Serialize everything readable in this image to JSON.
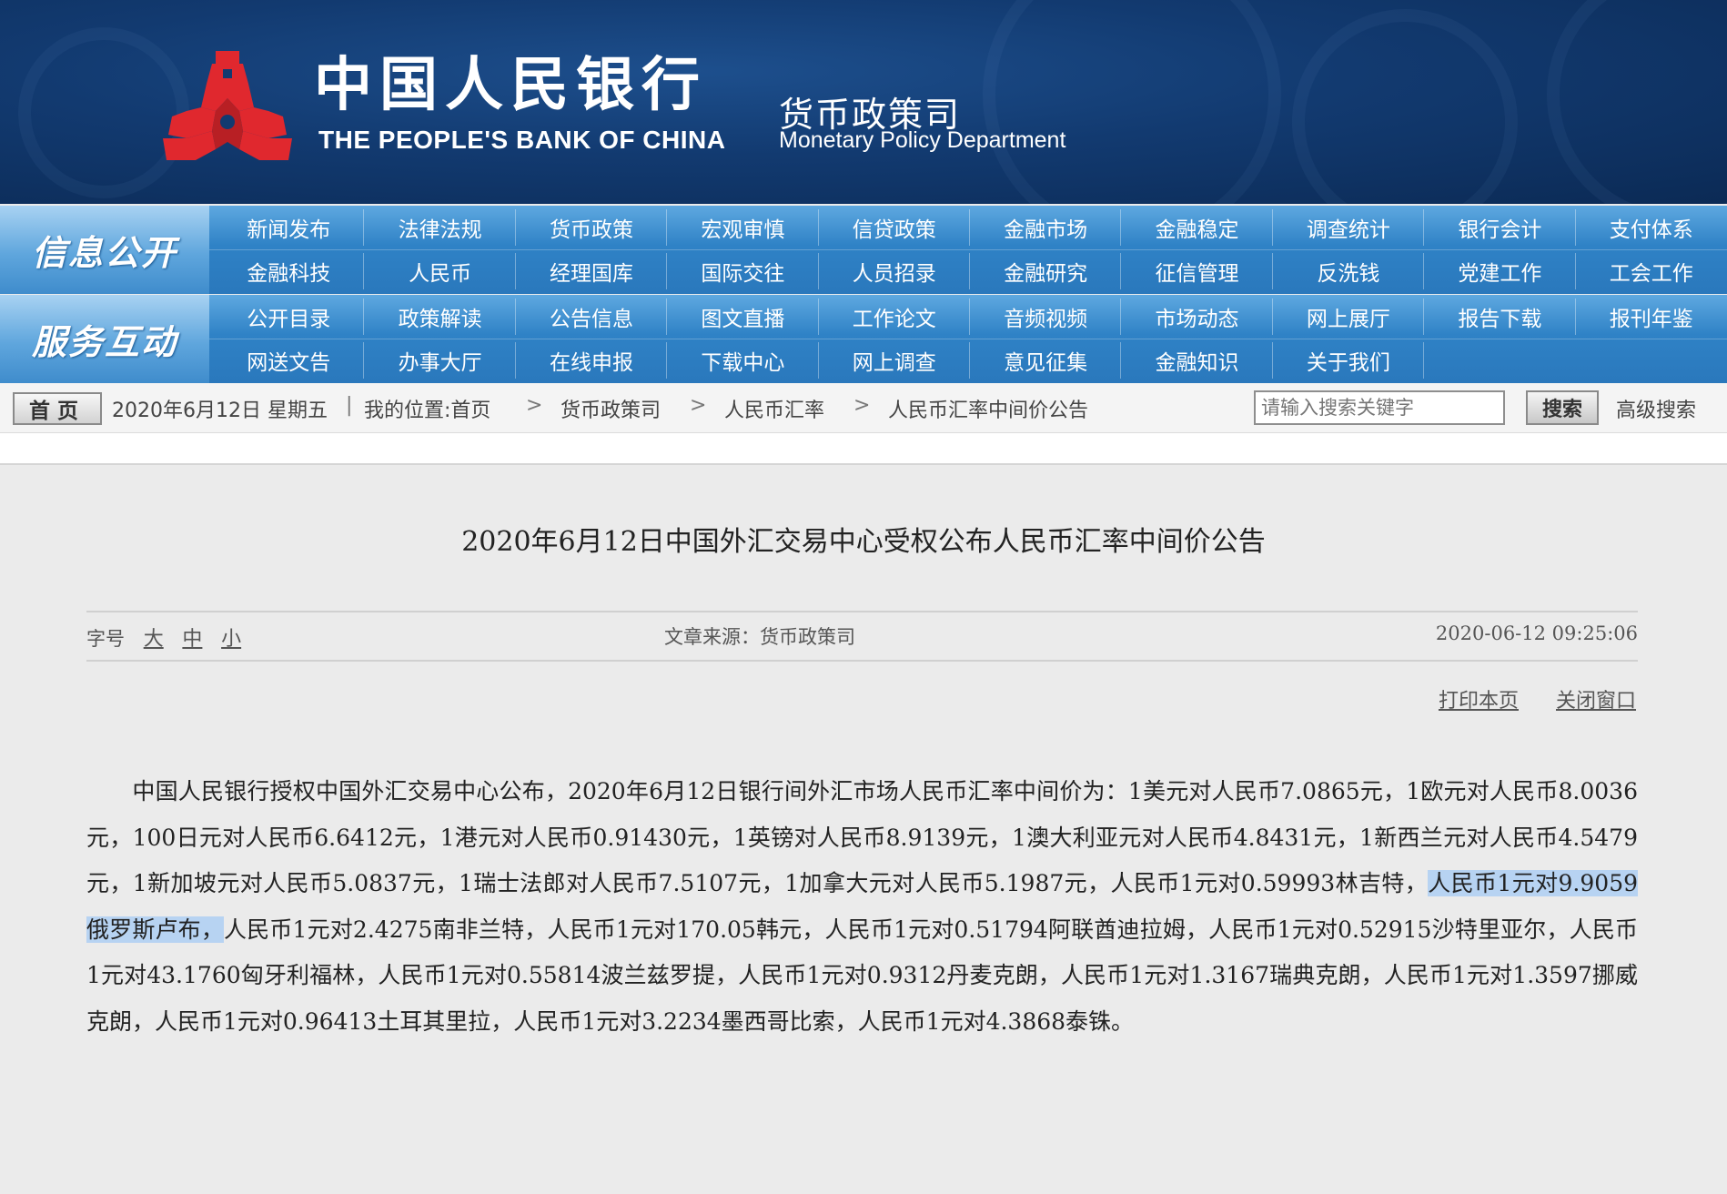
{
  "header": {
    "cn_title": "中国人民银行",
    "en_title": "THE PEOPLE'S BANK OF CHINA",
    "dept_cn": "货币政策司",
    "dept_en": "Monetary Policy Department",
    "colors": {
      "banner": "#123a70",
      "nav": "#2f82c6",
      "emblem": "#e0282e"
    }
  },
  "nav": {
    "info_open": {
      "heading": "信息公开",
      "items": [
        "新闻发布",
        "法律法规",
        "货币政策",
        "宏观审慎",
        "信贷政策",
        "金融市场",
        "金融稳定",
        "调查统计",
        "银行会计",
        "支付体系",
        "金融科技",
        "人民币",
        "经理国库",
        "国际交往",
        "人员招录",
        "金融研究",
        "征信管理",
        "反洗钱",
        "党建工作",
        "工会工作"
      ]
    },
    "service": {
      "heading": "服务互动",
      "items": [
        "公开目录",
        "政策解读",
        "公告信息",
        "图文直播",
        "工作论文",
        "音频视频",
        "市场动态",
        "网上展厅",
        "报告下载",
        "报刊年鉴",
        "网送文告",
        "办事大厅",
        "在线申报",
        "下载中心",
        "网上调查",
        "意见征集",
        "金融知识",
        "关于我们"
      ]
    }
  },
  "breadcrumb": {
    "home_button": "首页",
    "date": "2020年6月12日  星期五",
    "location_label": "我的位置:首页",
    "crumbs": [
      "货币政策司",
      "人民币汇率",
      "人民币汇率中间价公告"
    ],
    "separator": ">",
    "divider": "|",
    "search_placeholder": "请输入搜索关键字",
    "search_button": "搜索",
    "advanced_search": "高级搜索"
  },
  "article": {
    "title": "2020年6月12日中国外汇交易中心受权公布人民币汇率中间价公告",
    "font_size_label": "字号",
    "font_sizes": [
      "大",
      "中",
      "小"
    ],
    "source": "文章来源：货币政策司",
    "timestamp": "2020-06-12 09:25:06",
    "print": "打印本页",
    "close": "关闭窗口",
    "body_before": "中国人民银行授权中国外汇交易中心公布，2020年6月12日银行间外汇市场人民币汇率中间价为：1美元对人民币7.0865元，1欧元对人民币8.0036元，100日元对人民币6.6412元，1港元对人民币0.91430元，1英镑对人民币8.9139元，1澳大利亚元对人民币4.8431元，1新西兰元对人民币4.5479元，1新加坡元对人民币5.0837元，1瑞士法郎对人民币7.5107元，1加拿大元对人民币5.1987元，人民币1元对0.59993林吉特，",
    "body_highlight": "人民币1元对9.9059俄罗斯卢布，",
    "body_after": "人民币1元对2.4275南非兰特，人民币1元对170.05韩元，人民币1元对0.51794阿联酋迪拉姆，人民币1元对0.52915沙特里亚尔，人民币1元对43.1760匈牙利福林，人民币1元对0.55814波兰兹罗提，人民币1元对0.9312丹麦克朗，人民币1元对1.3167瑞典克朗，人民币1元对1.3597挪威克朗，人民币1元对0.96413土耳其里拉，人民币1元对3.2234墨西哥比索，人民币1元对4.3868泰铢。"
  }
}
